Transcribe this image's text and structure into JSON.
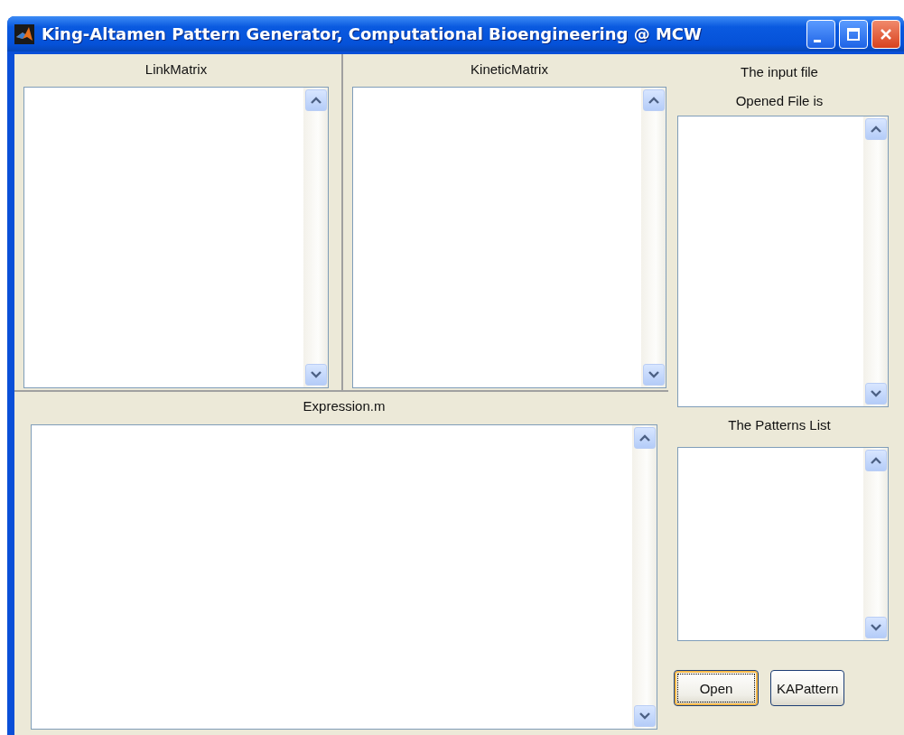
{
  "window": {
    "title": "King-Altamen Pattern Generator, Computational Bioengineering @ MCW"
  },
  "panels": [
    {
      "title": "LinkMatrix"
    },
    {
      "title": "KineticMatrix"
    },
    {
      "title": "Expression.m"
    }
  ],
  "sidebar": {
    "items": [
      {
        "kind": "label",
        "text": "The input file"
      },
      {
        "kind": "label",
        "text": "Opened File is"
      },
      {
        "kind": "listbox"
      },
      {
        "kind": "label",
        "text": "The Patterns List"
      },
      {
        "kind": "listbox"
      }
    ]
  },
  "buttons": [
    {
      "label": "Open",
      "focused": true
    },
    {
      "label": "KAPattern",
      "focused": false
    }
  ]
}
